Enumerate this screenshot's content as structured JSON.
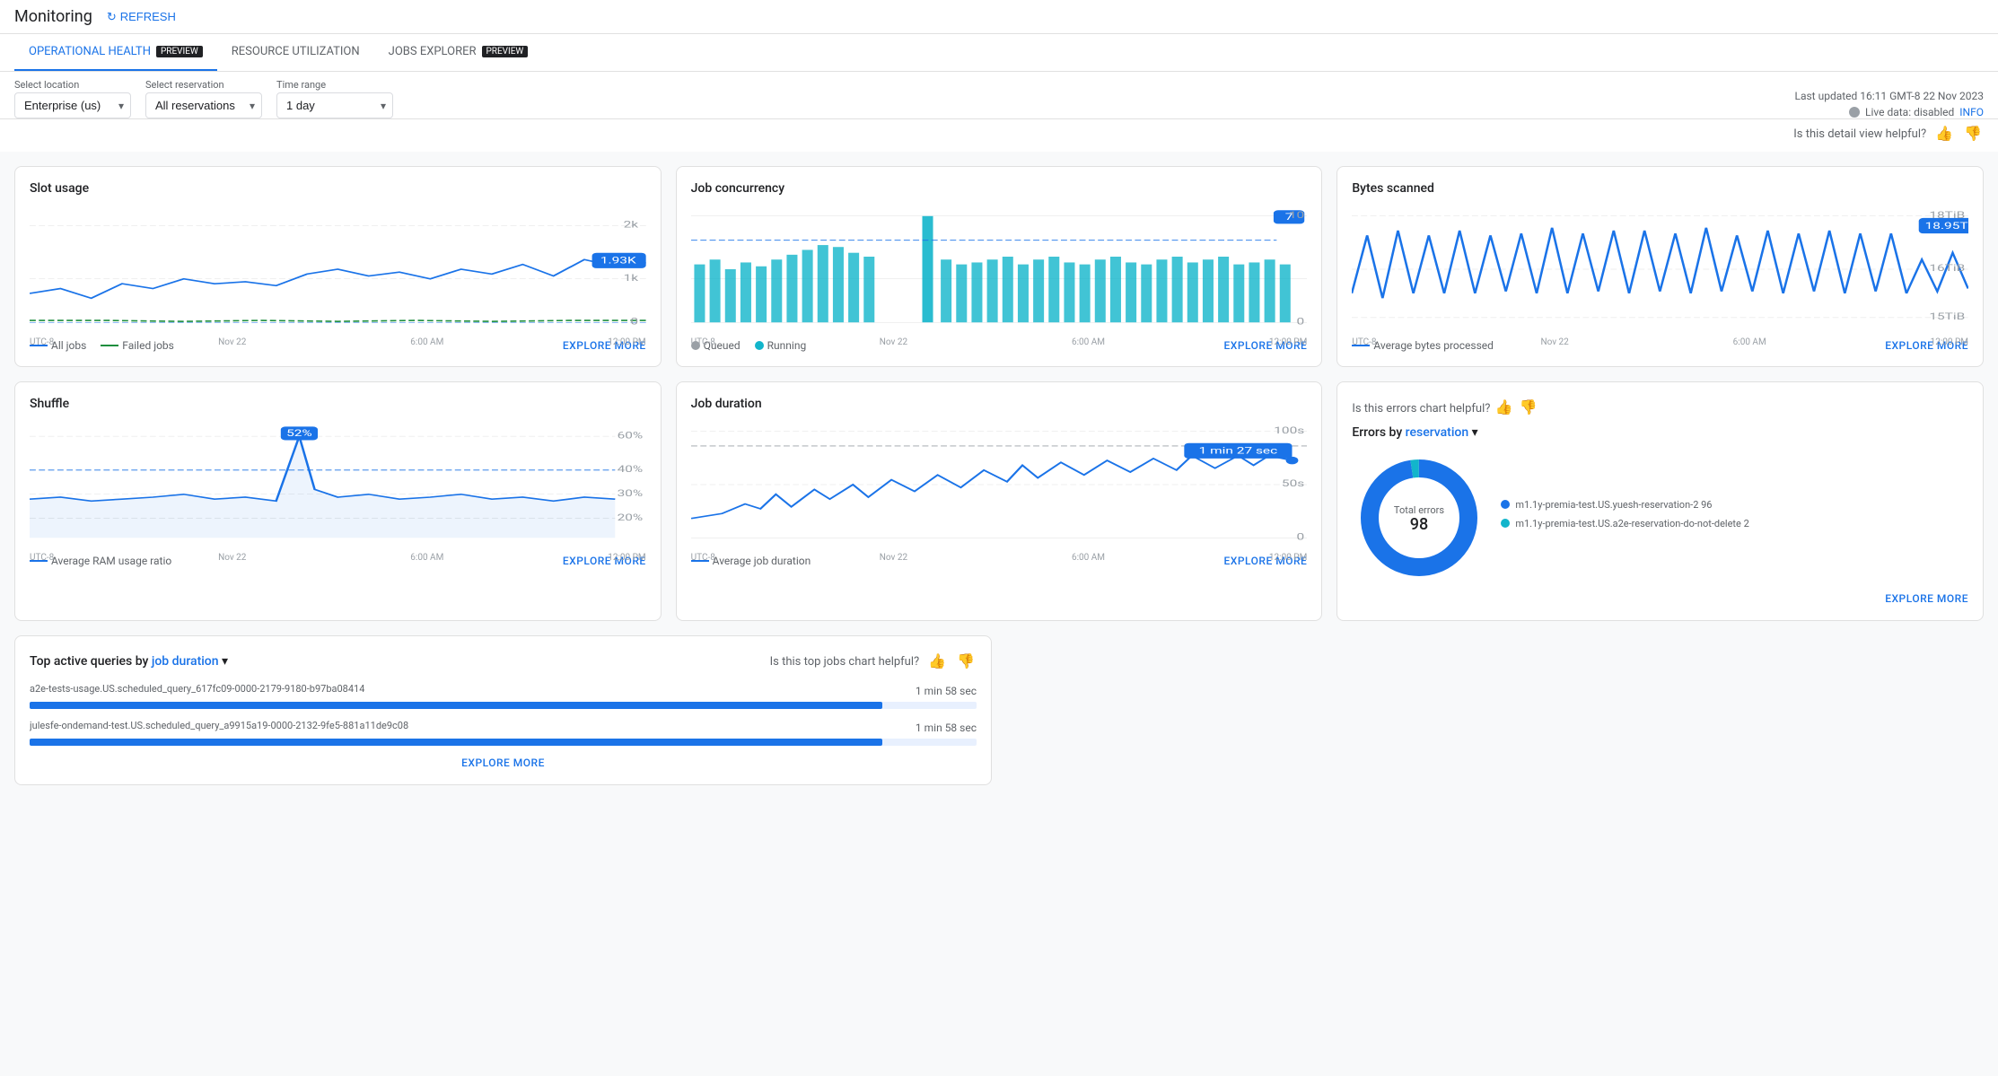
{
  "header": {
    "title": "Monitoring",
    "refresh_label": "REFRESH"
  },
  "tabs": [
    {
      "id": "operational-health",
      "label": "OPERATIONAL HEALTH",
      "preview": true,
      "active": true
    },
    {
      "id": "resource-utilization",
      "label": "RESOURCE UTILIZATION",
      "preview": false,
      "active": false
    },
    {
      "id": "jobs-explorer",
      "label": "JOBS EXPLORER",
      "preview": true,
      "active": false
    }
  ],
  "filters": {
    "location": {
      "label": "Select location",
      "value": "Enterprise (us)"
    },
    "reservation": {
      "label": "Select reservation",
      "value": "All reservations"
    },
    "time_range": {
      "label": "Time range",
      "value": "1 day"
    }
  },
  "status": {
    "last_updated": "Last updated 16:11 GMT-8 22 Nov 2023",
    "live_data": "Live data: disabled",
    "info": "INFO"
  },
  "feedback": {
    "helpful_text": "Is this detail view helpful?"
  },
  "slot_usage": {
    "title": "Slot usage",
    "tooltip": "1.93K",
    "y_max": "2k",
    "y_mid": "1k",
    "y_min": "0",
    "x_labels": [
      "UTC-8",
      "Nov 22",
      "6:00 AM",
      "12:00 PM"
    ],
    "legend": [
      "All jobs",
      "Failed jobs"
    ],
    "explore_more": "EXPLORE MORE"
  },
  "job_concurrency": {
    "title": "Job concurrency",
    "tooltip": "7",
    "y_max": "10",
    "y_min": "0",
    "x_labels": [
      "UTC-8",
      "Nov 22",
      "6:00 AM",
      "12:00 PM"
    ],
    "legend": [
      "Queued",
      "Running"
    ],
    "explore_more": "EXPLORE MORE"
  },
  "bytes_scanned": {
    "title": "Bytes scanned",
    "tooltip": "18.95T",
    "y_max": "18TiB",
    "y_mid": "16TiB",
    "y_min": "15TiB",
    "x_labels": [
      "UTC-8",
      "Nov 22",
      "6:00 AM",
      "12:00 PM"
    ],
    "legend": [
      "Average bytes processed"
    ],
    "explore_more": "EXPLORE MORE"
  },
  "shuffle": {
    "title": "Shuffle",
    "tooltip": "52%",
    "y_labels": [
      "60%",
      "40%",
      "30%",
      "20%"
    ],
    "x_labels": [
      "UTC-8",
      "Nov 22",
      "6:00 AM",
      "12:00 PM"
    ],
    "legend": [
      "Average RAM usage ratio"
    ],
    "explore_more": "EXPLORE MORE"
  },
  "job_duration": {
    "title": "Job duration",
    "tooltip": "1 min 27 sec",
    "y_max": "100s",
    "y_mid": "50s",
    "y_min": "0",
    "x_labels": [
      "UTC-8",
      "Nov 22",
      "6:00 AM",
      "12:00 PM"
    ],
    "legend": [
      "Average job duration"
    ],
    "explore_more": "EXPLORE MORE"
  },
  "errors": {
    "title": "Errors by",
    "reservation_label": "reservation",
    "helpful_text": "Is this errors chart helpful?",
    "total_label": "Total errors",
    "total_value": "98",
    "legend_items": [
      {
        "label": "m1.1y-premia-test.US.yuesh-reservation-2 96",
        "color": "#1a73e8"
      },
      {
        "label": "m1.1y-premia-test.US.a2e-reservation-do-not-delete 2",
        "color": "#12b5cb"
      }
    ],
    "explore_more": "EXPLORE MORE"
  },
  "top_queries": {
    "title": "Top active queries by",
    "sort_label": "job duration",
    "helpful_text": "Is this top jobs chart helpful?",
    "queries": [
      {
        "text": "a2e-tests-usage.US.scheduled_query_617fc09-0000-2179-9180-b97ba08414",
        "duration": "1 min 58 sec",
        "bar_width": "90%"
      },
      {
        "text": "julesfe-ondemand-test.US.scheduled_query_a9915a19-0000-2132-9fe5-881a11de9c08",
        "duration": "1 min 58 sec",
        "bar_width": "90%"
      }
    ],
    "explore_more": "EXPLORE MORE"
  }
}
